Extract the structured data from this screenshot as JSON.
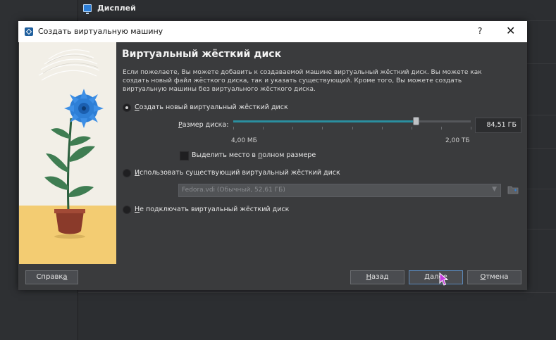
{
  "background": {
    "header_label": "Дисплей"
  },
  "dialog": {
    "title": "Создать виртуальную машину",
    "help_glyph": "?",
    "close_glyph": "✕",
    "heading": "Виртуальный жёсткий диск",
    "description": "Если пожелаете, Вы можете добавить к создаваемой машине виртуальный жёсткий диск. Вы можете как создать новый файл жёсткого диска, так и указать существующий. Кроме того, Вы можете создать виртуальную машины без виртуального жёсткого диска.",
    "options": {
      "create_new_prefix": "",
      "create_new_u": "С",
      "create_new_rest": "оздать новый виртуальный жёсткий диск",
      "use_existing_prefix": "",
      "use_existing_u": "И",
      "use_existing_rest": "спользовать существующий виртуальный жёсткий диск",
      "no_disk_prefix": "",
      "no_disk_u": "Н",
      "no_disk_rest": "е подключать виртуальный жёсткий диск"
    },
    "size_label_prefix": "",
    "size_label_u": "Р",
    "size_label_rest": "азмер диска:",
    "size_value": "84,51 ГБ",
    "size_fraction": 0.77,
    "min_label": "4,00 МБ",
    "max_label": "2,00 ТБ",
    "preallocate_prefix": "Выделить место в ",
    "preallocate_u": "п",
    "preallocate_rest": "олном размере",
    "existing_disk_value": "Fedora.vdi (Обычный, 52,61 ГБ)",
    "buttons": {
      "help_prefix": "Справк",
      "help_u": "а",
      "back_prefix": "",
      "back_u": "Н",
      "back_rest": "азад",
      "next": "Далее",
      "cancel_prefix": "",
      "cancel_u": "О",
      "cancel_rest": "тмена"
    }
  },
  "colors": {
    "accent": "#2a8fa0",
    "dialog_bg": "#3a3b3d",
    "flower": "#2e7fd6"
  }
}
